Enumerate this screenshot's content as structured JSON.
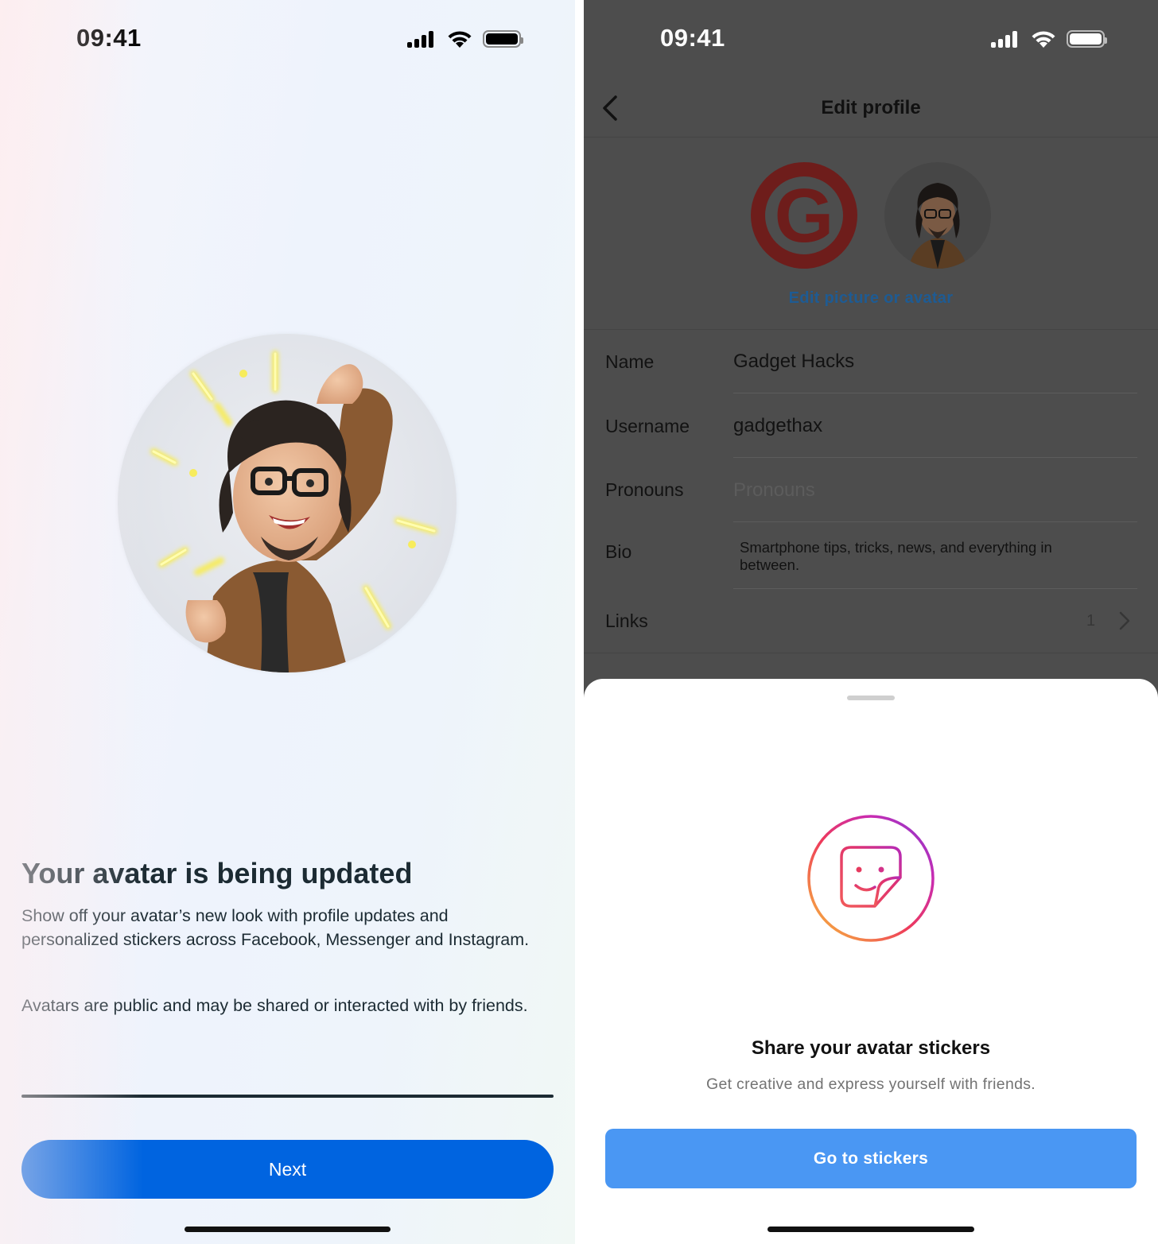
{
  "left_screen": {
    "status_bar": {
      "time": "09:41"
    },
    "title": "Your avatar is being updated",
    "paragraph1": "Show off your avatar’s new look with profile updates and personalized stickers across Facebook, Messenger and Instagram.",
    "paragraph2": "Avatars are public and may be shared or interacted with by friends.",
    "next_label": "Next",
    "avatar_icon": "avatar-celebrating-icon"
  },
  "right_screen": {
    "status_bar": {
      "time": "09:41"
    },
    "header": {
      "title": "Edit profile",
      "back_icon": "chevron-left-icon"
    },
    "edit_picture_label": "Edit picture or avatar",
    "profile_logo_letter": "G",
    "fields": {
      "name": {
        "label": "Name",
        "value": "Gadget Hacks"
      },
      "username": {
        "label": "Username",
        "value": "gadgethax"
      },
      "pronouns": {
        "label": "Pronouns",
        "placeholder": "Pronouns"
      },
      "bio": {
        "label": "Bio",
        "value": "Smartphone tips, tricks, news, and everything in between."
      },
      "links": {
        "label": "Links",
        "count": "1"
      }
    },
    "sheet": {
      "icon": "sticker-smiley-icon",
      "title": "Share your avatar stickers",
      "subtitle": "Get creative and express yourself with friends.",
      "button_label": "Go to stickers"
    }
  },
  "colors": {
    "next_button": "#0064e0",
    "stickers_button": "#4a97f3",
    "edit_link": "#1e5b93",
    "dark_text": "#1c2b33"
  }
}
